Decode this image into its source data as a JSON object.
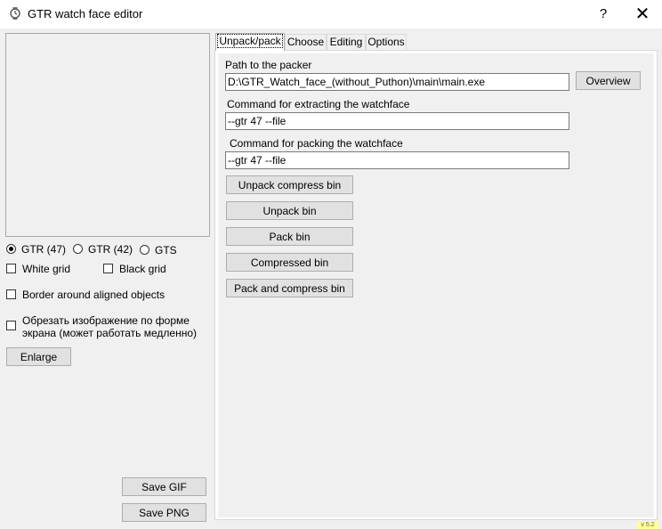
{
  "window": {
    "title": "GTR watch face editor",
    "help_label": "?",
    "close_label": "✕",
    "icon": "watch-icon"
  },
  "left": {
    "models": [
      {
        "label": "GTR (47)",
        "checked": true
      },
      {
        "label": "GTR (42)",
        "checked": false
      },
      {
        "label": "GTS",
        "checked": false
      }
    ],
    "white_grid": "White grid",
    "black_grid": "Black grid",
    "border_aligned": "Border around aligned objects",
    "crop_line1": "Обрезать изображение по форме",
    "crop_line2": "экрана (может работать медленно)",
    "enlarge": "Enlarge",
    "save_gif": "Save GIF",
    "save_png": "Save PNG"
  },
  "tabs": [
    "Unpack/pack",
    "Choose",
    "Editing",
    "Options"
  ],
  "unpack": {
    "packer_label": "Path to the packer",
    "packer_path": "D:\\GTR_Watch_face_(without_Puthon)\\main\\main.exe",
    "overview": "Overview",
    "extract_label": "Command for extracting the watchface",
    "extract_cmd": "--gtr 47 --file",
    "pack_label": "Command for packing the watchface",
    "pack_cmd": "--gtr 47 --file",
    "buttons": [
      "Unpack compress bin",
      "Unpack bin",
      "Pack bin",
      "Compressed bin",
      "Pack and compress bin"
    ]
  },
  "version": "v 5.2"
}
